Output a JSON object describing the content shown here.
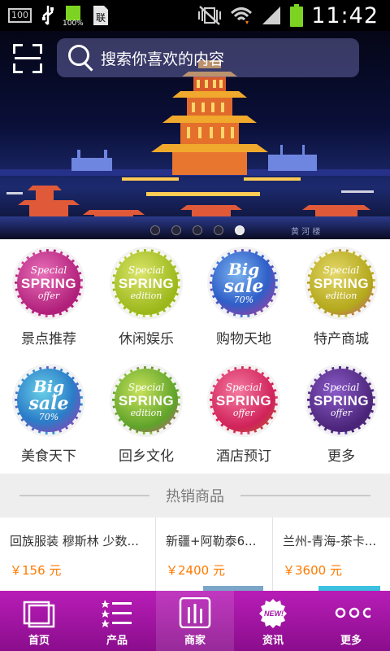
{
  "status_bar": {
    "time": "11:42",
    "battery_small_label": "100%",
    "badge_text": "100",
    "sim_text": "联"
  },
  "banner": {
    "search_placeholder": "搜索你喜欢的内容",
    "watermark": "黄 河 楼",
    "slide_count": 5,
    "active_slide": 5
  },
  "categories": [
    {
      "label": "景点推荐",
      "badge": [
        "Special",
        "SPRING",
        "offer"
      ],
      "color": "#c2227e"
    },
    {
      "label": "休闲娱乐",
      "badge": [
        "Special",
        "SPRING",
        "edition"
      ],
      "color": "#a8c21a"
    },
    {
      "label": "购物天地",
      "badge": [
        "Big",
        "sale",
        "70%"
      ],
      "color": "#3a6fd0"
    },
    {
      "label": "特产商城",
      "badge": [
        "Special",
        "SPRING",
        "edition"
      ],
      "color": "#b9b51c"
    },
    {
      "label": "美食天下",
      "badge": [
        "Big",
        "sale",
        "70%"
      ],
      "color": "#2a7dc8"
    },
    {
      "label": "回乡文化",
      "badge": [
        "Special",
        "SPRING",
        "edition"
      ],
      "color": "#5fa32a"
    },
    {
      "label": "酒店预订",
      "badge": [
        "Special",
        "SPRING",
        "offer"
      ],
      "color": "#e0306a"
    },
    {
      "label": "更多",
      "badge": [
        "Special",
        "SPRING",
        "offer"
      ],
      "color": "#5a2d8a"
    }
  ],
  "hot": {
    "title": "热销商品",
    "products": [
      {
        "name": "回族服装 穆斯林 少数...",
        "price": "￥156 元"
      },
      {
        "name": "新疆+阿勒泰6...",
        "price": "￥2400 元"
      },
      {
        "name": "兰州-青海-茶卡...",
        "price": "￥3600 元"
      }
    ]
  },
  "bottom_nav": [
    {
      "label": "首页",
      "icon": "home-icon"
    },
    {
      "label": "产品",
      "icon": "list-icon"
    },
    {
      "label": "商家",
      "icon": "merchant-icon"
    },
    {
      "label": "资讯",
      "icon": "news-icon"
    },
    {
      "label": "更多",
      "icon": "more-icon"
    }
  ],
  "colors": {
    "nav_bg": "#a515a5",
    "price": "#ff7a00"
  }
}
